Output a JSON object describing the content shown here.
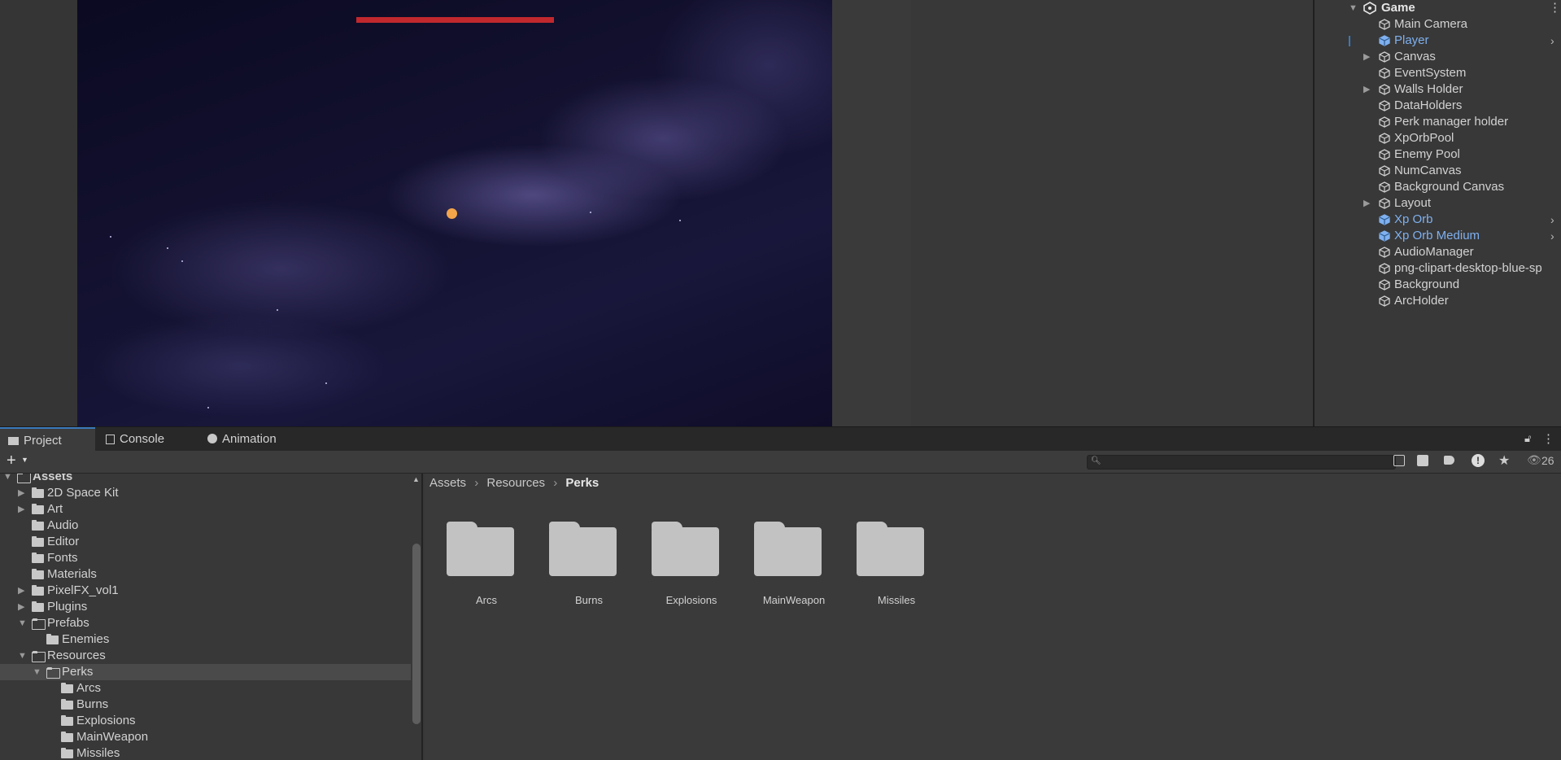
{
  "hierarchy": {
    "scene_name": "Game",
    "items": [
      {
        "label": "Main Camera",
        "prefab": false,
        "expandable": false,
        "chevron": false
      },
      {
        "label": "Player",
        "prefab": true,
        "expandable": false,
        "chevron": true
      },
      {
        "label": "Canvas",
        "prefab": false,
        "expandable": true,
        "chevron": false
      },
      {
        "label": "EventSystem",
        "prefab": false,
        "expandable": false,
        "chevron": false
      },
      {
        "label": "Walls Holder",
        "prefab": false,
        "expandable": true,
        "chevron": false
      },
      {
        "label": "DataHolders",
        "prefab": false,
        "expandable": false,
        "chevron": false
      },
      {
        "label": "Perk manager holder",
        "prefab": false,
        "expandable": false,
        "chevron": false
      },
      {
        "label": "XpOrbPool",
        "prefab": false,
        "expandable": false,
        "chevron": false
      },
      {
        "label": "Enemy Pool",
        "prefab": false,
        "expandable": false,
        "chevron": false
      },
      {
        "label": "NumCanvas",
        "prefab": false,
        "expandable": false,
        "chevron": false
      },
      {
        "label": "Background Canvas",
        "prefab": false,
        "expandable": false,
        "chevron": false
      },
      {
        "label": "Layout",
        "prefab": false,
        "expandable": true,
        "chevron": false
      },
      {
        "label": "Xp Orb",
        "prefab": true,
        "expandable": false,
        "chevron": true
      },
      {
        "label": "Xp Orb Medium",
        "prefab": true,
        "expandable": false,
        "chevron": true
      },
      {
        "label": "AudioManager",
        "prefab": false,
        "expandable": false,
        "chevron": false
      },
      {
        "label": "png-clipart-desktop-blue-sp",
        "prefab": false,
        "expandable": false,
        "chevron": false
      },
      {
        "label": "Background",
        "prefab": false,
        "expandable": false,
        "chevron": false
      },
      {
        "label": "ArcHolder",
        "prefab": false,
        "expandable": false,
        "chevron": false
      }
    ]
  },
  "tabs": {
    "project": "Project",
    "console": "Console",
    "animation": "Animation"
  },
  "toolbar": {
    "add_label": "+",
    "hidden_count": "26"
  },
  "tree": {
    "items": [
      {
        "label": "Assets",
        "depth": 0,
        "open": true,
        "expandable": true,
        "selected": false
      },
      {
        "label": "2D Space Kit",
        "depth": 1,
        "open": false,
        "expandable": true,
        "selected": false
      },
      {
        "label": "Art",
        "depth": 1,
        "open": false,
        "expandable": true,
        "selected": false
      },
      {
        "label": "Audio",
        "depth": 1,
        "open": false,
        "expandable": false,
        "selected": false
      },
      {
        "label": "Editor",
        "depth": 1,
        "open": false,
        "expandable": false,
        "selected": false
      },
      {
        "label": "Fonts",
        "depth": 1,
        "open": false,
        "expandable": false,
        "selected": false
      },
      {
        "label": "Materials",
        "depth": 1,
        "open": false,
        "expandable": false,
        "selected": false
      },
      {
        "label": "PixelFX_vol1",
        "depth": 1,
        "open": false,
        "expandable": true,
        "selected": false
      },
      {
        "label": "Plugins",
        "depth": 1,
        "open": false,
        "expandable": true,
        "selected": false
      },
      {
        "label": "Prefabs",
        "depth": 1,
        "open": true,
        "expandable": true,
        "selected": false
      },
      {
        "label": "Enemies",
        "depth": 2,
        "open": false,
        "expandable": false,
        "selected": false
      },
      {
        "label": "Resources",
        "depth": 1,
        "open": true,
        "expandable": true,
        "selected": false
      },
      {
        "label": "Perks",
        "depth": 2,
        "open": true,
        "expandable": true,
        "selected": true
      },
      {
        "label": "Arcs",
        "depth": 3,
        "open": false,
        "expandable": false,
        "selected": false
      },
      {
        "label": "Burns",
        "depth": 3,
        "open": false,
        "expandable": false,
        "selected": false
      },
      {
        "label": "Explosions",
        "depth": 3,
        "open": false,
        "expandable": false,
        "selected": false
      },
      {
        "label": "MainWeapon",
        "depth": 3,
        "open": false,
        "expandable": false,
        "selected": false
      },
      {
        "label": "Missiles",
        "depth": 3,
        "open": false,
        "expandable": false,
        "selected": false
      }
    ]
  },
  "breadcrumb": {
    "root": "Assets",
    "middle": "Resources",
    "current": "Perks",
    "separator": "›"
  },
  "folders": [
    "Arcs",
    "Burns",
    "Explosions",
    "MainWeapon",
    "Missiles"
  ],
  "colors": {
    "health_bar": "#c0282e",
    "player": "#f4a54a",
    "prefab_text": "#7fb0ef",
    "accent": "#3a79bb"
  }
}
